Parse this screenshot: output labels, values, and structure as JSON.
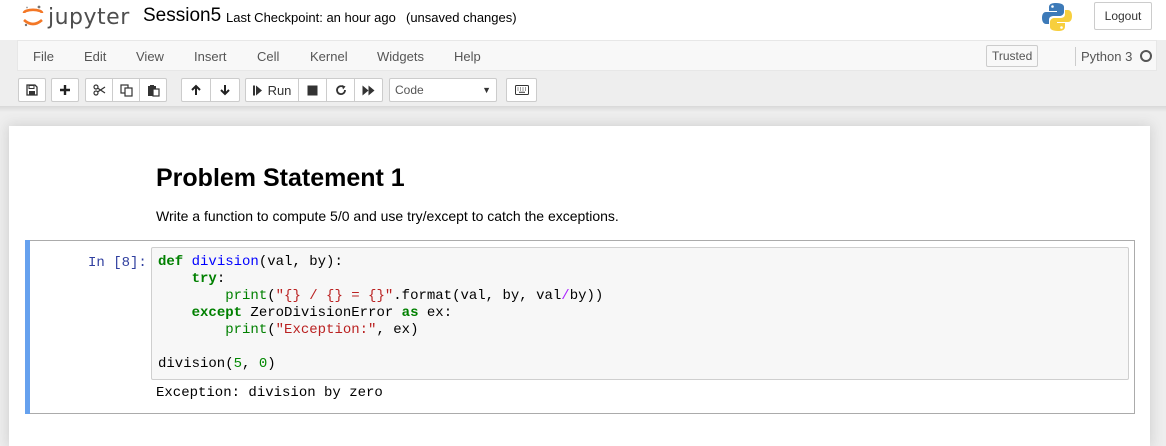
{
  "header": {
    "logo_text": "jupyter",
    "notebook_name": "Session5",
    "checkpoint": "Last Checkpoint: an hour ago",
    "autosave_status": "(unsaved changes)",
    "logout_label": "Logout"
  },
  "menubar": {
    "items": [
      "File",
      "Edit",
      "View",
      "Insert",
      "Cell",
      "Kernel",
      "Widgets",
      "Help"
    ],
    "trusted_label": "Trusted",
    "kernel_name": "Python 3"
  },
  "toolbar": {
    "run_label": "Run",
    "cell_type": "Code"
  },
  "notebook": {
    "markdown_title": "Problem Statement 1",
    "markdown_text": "Write a function to compute 5/0 and use try/except to catch the exceptions.",
    "cell": {
      "prompt": "In [8]:",
      "code_lines": [
        "def division(val, by):",
        "    try:",
        "        print(\"{} / {} = {}\".format(val, by, val/by))",
        "    except ZeroDivisionError as ex:",
        "        print(\"Exception:\", ex)",
        "",
        "division(5, 0)"
      ],
      "output": "Exception: division by zero"
    }
  },
  "colors": {
    "cell_selected_bar": "#66a1ee",
    "prompt": "#303f9f",
    "keyword": "#008000",
    "function": "#0000ff",
    "string": "#ba2121"
  },
  "icons": [
    "save-icon",
    "plus-icon",
    "cut-icon",
    "copy-icon",
    "paste-icon",
    "arrow-up-icon",
    "arrow-down-icon",
    "step-forward-icon",
    "stop-icon",
    "refresh-icon",
    "fast-forward-icon",
    "keyboard-icon"
  ]
}
